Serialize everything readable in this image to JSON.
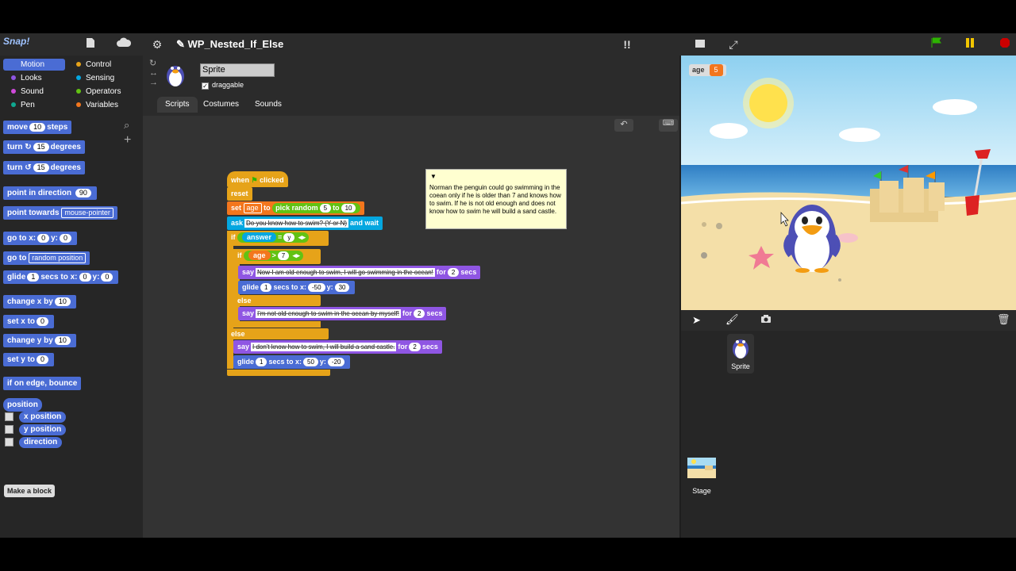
{
  "app": {
    "logo": "Snap!",
    "title": "WP_Nested_If_Else"
  },
  "categories": [
    {
      "label": "Motion",
      "color": "#4a6cd4",
      "selected": true
    },
    {
      "label": "Looks",
      "color": "#8f56e3"
    },
    {
      "label": "Sound",
      "color": "#cf4ad9"
    },
    {
      "label": "Pen",
      "color": "#0fa890"
    },
    {
      "label": "Control",
      "color": "#e6a319"
    },
    {
      "label": "Sensing",
      "color": "#04a7e0"
    },
    {
      "label": "Operators",
      "color": "#62c213"
    },
    {
      "label": "Variables",
      "color": "#f3761d"
    }
  ],
  "palette": {
    "move": {
      "a": "move",
      "v": "10",
      "b": "steps"
    },
    "turn_cw": {
      "a": "turn",
      "v": "15",
      "b": "degrees"
    },
    "turn_ccw": {
      "a": "turn",
      "v": "15",
      "b": "degrees"
    },
    "point_dir": {
      "a": "point in direction",
      "v": "90"
    },
    "point_towards": {
      "a": "point towards",
      "v": "mouse-pointer"
    },
    "goto_xy": {
      "a": "go to x:",
      "x": "0",
      "b": "y:",
      "y": "0"
    },
    "goto": {
      "a": "go to",
      "v": "random position"
    },
    "glide": {
      "a": "glide",
      "v": "1",
      "b": "secs to x:",
      "x": "0",
      "c": "y:",
      "y": "0"
    },
    "change_x": {
      "a": "change x by",
      "v": "10"
    },
    "set_x": {
      "a": "set x to",
      "v": "0"
    },
    "change_y": {
      "a": "change y by",
      "v": "10"
    },
    "set_y": {
      "a": "set y to",
      "v": "0"
    },
    "bounce": "if on edge, bounce",
    "position": "position",
    "x_position": "x position",
    "y_position": "y position",
    "direction": "direction",
    "make_block": "Make a block"
  },
  "sprite": {
    "name": "Sprite",
    "draggable_label": "draggable",
    "draggable_check": "✓"
  },
  "tabs": [
    "Scripts",
    "Costumes",
    "Sounds"
  ],
  "script": {
    "hat": {
      "a": "when",
      "b": "clicked"
    },
    "reset": "reset",
    "set": {
      "a": "set",
      "var": "age",
      "b": "to",
      "c": "pick random",
      "lo": "5",
      "d": "to",
      "hi": "10"
    },
    "ask": {
      "a": "ask",
      "q": "Do you know how to swim? (Y or N)",
      "b": "and wait"
    },
    "if1": {
      "a": "if",
      "var": "answer",
      "op": "=",
      "val": "y"
    },
    "if2": {
      "a": "if",
      "var": "age",
      "op": ">",
      "val": "7"
    },
    "say1": {
      "a": "say",
      "msg": "Now I am old enough to swim, I will go swimming in the ocean!",
      "b": "for",
      "n": "2",
      "c": "secs"
    },
    "glide1": {
      "a": "glide",
      "n": "1",
      "b": "secs to x:",
      "x": "-50",
      "c": "y:",
      "y": "30"
    },
    "else1": "else",
    "say2": {
      "a": "say",
      "msg": "I'm not old enough to swim in the ocean by myself!",
      "b": "for",
      "n": "2",
      "c": "secs"
    },
    "else2": "else",
    "say3": {
      "a": "say",
      "msg": "I don't know how to swim, I will build a sand castle.",
      "b": "for",
      "n": "2",
      "c": "secs"
    },
    "glide2": {
      "a": "glide",
      "n": "1",
      "b": "secs to x:",
      "x": "50",
      "c": "y:",
      "y": "-20"
    }
  },
  "comment": "Norman the penguin could go swimming in the coean only if he is older than 7 and knows how to swim. If he is not old enough and does not know how to swim he will build a sand castle.",
  "stage": {
    "watcher_label": "age",
    "watcher_value": "5"
  },
  "corral": {
    "sprite_label": "Sprite",
    "stage_label": "Stage"
  },
  "colors": {
    "accent": "#4a6cd4",
    "control": "#e6a319",
    "looks": "#8f56e3",
    "variables": "#f3761d",
    "operators": "#62c213",
    "sensing": "#04a7e0"
  }
}
